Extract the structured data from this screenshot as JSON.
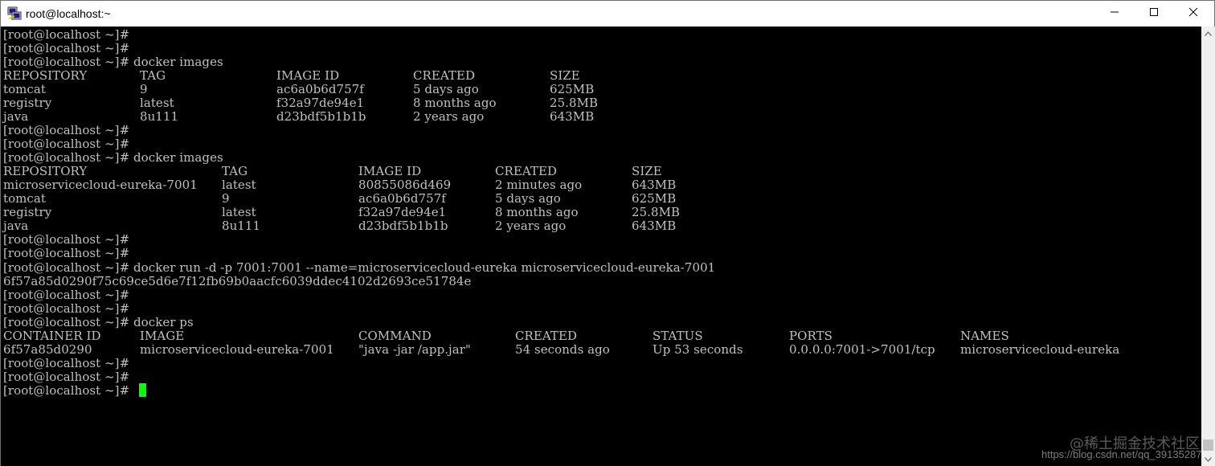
{
  "window": {
    "title": "root@localhost:~",
    "icon": "putty-icon",
    "controls": [
      "minimize-icon",
      "maximize-icon",
      "close-icon"
    ]
  },
  "terminal": {
    "cursor_color": "#00ff00",
    "text_color": "#c0c0c0",
    "background": "#000000",
    "lines": [
      {
        "cols": [
          "[root@localhost ~]#"
        ]
      },
      {
        "cols": [
          "[root@localhost ~]#"
        ]
      },
      {
        "cols": [
          "[root@localhost ~]# docker images"
        ]
      },
      {
        "cols": [
          "REPOSITORY",
          "TAG",
          "IMAGE ID",
          "CREATED",
          "SIZE"
        ]
      },
      {
        "cols": [
          "tomcat",
          "9",
          "ac6a0b6d757f",
          "5 days ago",
          "625MB"
        ]
      },
      {
        "cols": [
          "registry",
          "latest",
          "f32a97de94e1",
          "8 months ago",
          "25.8MB"
        ]
      },
      {
        "cols": [
          "java",
          "8u111",
          "d23bdf5b1b1b",
          "2 years ago",
          "643MB"
        ]
      },
      {
        "cols": [
          "[root@localhost ~]#"
        ]
      },
      {
        "cols": [
          "[root@localhost ~]#"
        ]
      },
      {
        "cols": [
          "[root@localhost ~]# docker images"
        ]
      },
      {
        "cols": [
          "REPOSITORY",
          "TAG",
          "IMAGE ID",
          "CREATED",
          "SIZE"
        ]
      },
      {
        "cols": [
          "microservicecloud-eureka-7001",
          "latest",
          "80855086d469",
          "2 minutes ago",
          "643MB"
        ]
      },
      {
        "cols": [
          "tomcat",
          "9",
          "ac6a0b6d757f",
          "5 days ago",
          "625MB"
        ]
      },
      {
        "cols": [
          "registry",
          "latest",
          "f32a97de94e1",
          "8 months ago",
          "25.8MB"
        ]
      },
      {
        "cols": [
          "java",
          "8u111",
          "d23bdf5b1b1b",
          "2 years ago",
          "643MB"
        ]
      },
      {
        "cols": [
          "[root@localhost ~]#"
        ]
      },
      {
        "cols": [
          "[root@localhost ~]#"
        ]
      },
      {
        "cols": [
          "[root@localhost ~]# docker run -d -p 7001:7001 --name=microservicecloud-eureka microservicecloud-eureka-7001"
        ]
      },
      {
        "cols": [
          "6f57a85d0290f75c69ce5d6e7f12fb69b0aacfc6039ddec4102d2693ce51784e"
        ]
      },
      {
        "cols": [
          "[root@localhost ~]#"
        ]
      },
      {
        "cols": [
          "[root@localhost ~]#"
        ]
      },
      {
        "cols": [
          "[root@localhost ~]# docker ps"
        ]
      },
      {
        "cols": [
          "CONTAINER ID",
          "IMAGE",
          "COMMAND",
          "CREATED",
          "STATUS",
          "PORTS",
          "NAMES"
        ]
      },
      {
        "cols": [
          "6f57a85d0290",
          "microservicecloud-eureka-7001",
          "\"java -jar /app.jar\"",
          "54 seconds ago",
          "Up 53 seconds",
          "0.0.0.0:7001->7001/tcp",
          "microservicecloud-eureka"
        ]
      },
      {
        "cols": [
          "[root@localhost ~]#"
        ]
      },
      {
        "cols": [
          "[root@localhost ~]#"
        ]
      },
      {
        "cols": [
          "[root@localhost ~]#"
        ]
      }
    ]
  },
  "watermark": {
    "site_name": "@稀土掘金技术社区",
    "url": "https://blog.csdn.net/qq_39135287"
  }
}
